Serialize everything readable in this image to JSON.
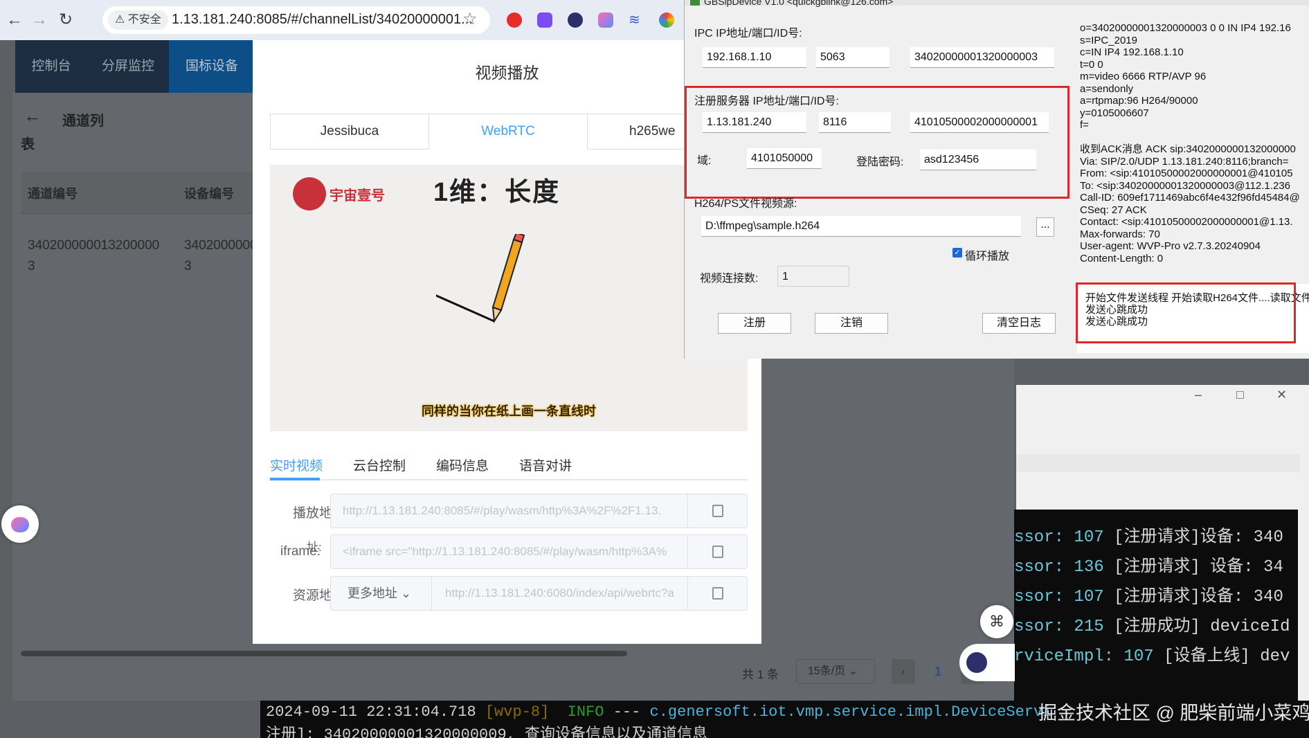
{
  "browser": {
    "insecure_label": "不安全",
    "url": "1.13.181.240:8085/#/channelList/34020000001..."
  },
  "app": {
    "nav": [
      "控制台",
      "分屏监控",
      "国标设备"
    ],
    "page_title_1": "通道列",
    "page_title_2": "表",
    "columns": [
      "通道编号",
      "设备编号"
    ],
    "row": {
      "channel_1": "340200000013200000",
      "channel_2": "3",
      "device_1": "3402000000",
      "device_2": "3"
    },
    "pagination": {
      "total": "共 1 条",
      "size": "15条/页",
      "page": "1"
    }
  },
  "dialog": {
    "title": "视频播放",
    "tabs": [
      "Jessibuca",
      "WebRTC",
      "h265we"
    ],
    "active_tab": "WebRTC",
    "video": {
      "logo": "宇宙壹号",
      "title": "1维：长度",
      "subtitle": "同样的当你在纸上画一条直线时"
    },
    "subtabs": [
      "实时视频",
      "云台控制",
      "编码信息",
      "语音对讲"
    ],
    "fields": [
      {
        "label": "播放地",
        "value": "http://1.13.181.240:8085/#/play/wasm/http%3A%2F%2F1.13."
      },
      {
        "label": "iframe:",
        "label_extra": "址:",
        "value": "<iframe src=\"http://1.13.181.240:8085/#/play/wasm/http%3A%"
      },
      {
        "label": "资源地",
        "select": "更多地址",
        "value": "http://1.13.181.240:6080/index/api/webrtc?a"
      }
    ]
  },
  "gbs": {
    "window_title": "GBSipDevice V1.0 <quickgbiink@126.com>",
    "ipc_label": "IPC  IP地址/端口/ID号:",
    "ipc_ip": "192.168.1.10",
    "ipc_port": "5063",
    "ipc_id": "34020000001320000003",
    "reg_label": "注册服务器  IP地址/端口/ID号:",
    "reg_ip": "1.13.181.240",
    "reg_port": "8116",
    "reg_id": "41010500002000000001",
    "domain_label": "域:",
    "domain": "4101050000",
    "pwd_label": "登陆密码:",
    "pwd": "asd123456",
    "file_label": "H264/PS文件视频源:",
    "file_path": "D:\\ffmpeg\\sample.h264",
    "browse": "...",
    "loop_label": "循环播放",
    "conn_label": "视频连接数:",
    "conn": "1",
    "btn_register": "注册",
    "btn_unregister": "注销",
    "btn_clear": "清空日志",
    "sdp": "o=34020000001320000003 0 0 IN IP4 192.16\ns=IPC_2019\nc=IN IP4 192.168.1.10\nt=0 0\nm=video 6666 RTP/AVP 96\na=sendonly\na=rtpmap:96 H264/90000\ny=0105006607\nf=\n\n收到ACK消息 ACK sip:3402000000132000000\nVia: SIP/2.0/UDP 1.13.181.240:8116;branch=\nFrom: <sip:41010500002000000001@410105\nTo: <sip:34020000001320000003@112.1.236\nCall-ID: 609ef1711469abc6f4e432f96fd45484@\nCSeq: 27 ACK\nContact: <sip:41010500002000000001@1.13.\nMax-forwards: 70\nUser-agent: WVP-Pro v2.7.3.20240904\nContent-Length: 0",
    "log": "开始文件发送线程 开始读取H264文件....读取文件\n发送心跳成功\n发送心跳成功"
  },
  "console": {
    "lines": [
      {
        "a": "ssor",
        "b": "107",
        "c": "[注册请求]设备: 340"
      },
      {
        "a": "ssor",
        "b": "136",
        "c": "[注册请求] 设备: 34"
      },
      {
        "a": "ssor",
        "b": "107",
        "c": "[注册请求]设备: 340"
      },
      {
        "a": "ssor",
        "b": "215",
        "c": "[注册成功] deviceId"
      },
      {
        "a": "rviceImpl",
        "b": "107",
        "c": "[设备上线] dev"
      }
    ],
    "bottom_1_time": "2024-09-11 22:31:04.718",
    "bottom_1_thread": "[wvp-8]",
    "bottom_1_level": "INFO",
    "bottom_1_rest": "---",
    "bottom_1_class": "c.genersoft.iot.vmp.service.impl.DeviceServi",
    "bottom_2": "注册]: 34020000001320000009, 查询设备信息以及通道信息"
  },
  "watermark": "掘金技术社区 @ 肥柴前端小菜鸡"
}
